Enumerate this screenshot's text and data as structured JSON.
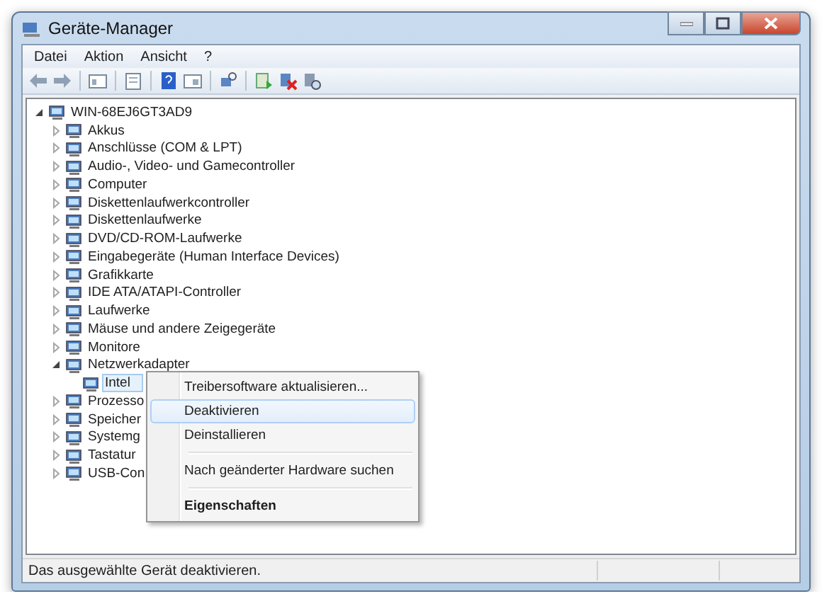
{
  "window": {
    "title": "Geräte-Manager"
  },
  "menu": [
    {
      "label": "Datei"
    },
    {
      "label": "Aktion"
    },
    {
      "label": "Ansicht"
    },
    {
      "label": "?"
    }
  ],
  "tree": {
    "label": "WIN-68EJ6GT3AD9",
    "expanded": true,
    "selected": false,
    "children": [
      {
        "label": "Akkus",
        "expanded": false,
        "selected": false
      },
      {
        "label": "Anschlüsse (COM & LPT)",
        "expanded": false,
        "selected": false
      },
      {
        "label": "Audio-, Video- und Gamecontroller",
        "expanded": false,
        "selected": false
      },
      {
        "label": "Computer",
        "expanded": false,
        "selected": false
      },
      {
        "label": "Diskettenlaufwerkcontroller",
        "expanded": false,
        "selected": false
      },
      {
        "label": "Diskettenlaufwerke",
        "expanded": false,
        "selected": false
      },
      {
        "label": "DVD/CD-ROM-Laufwerke",
        "expanded": false,
        "selected": false
      },
      {
        "label": "Eingabegeräte (Human Interface Devices)",
        "expanded": false,
        "selected": false
      },
      {
        "label": "Grafikkarte",
        "expanded": false,
        "selected": false
      },
      {
        "label": "IDE ATA/ATAPI-Controller",
        "expanded": false,
        "selected": false
      },
      {
        "label": "Laufwerke",
        "expanded": false,
        "selected": false
      },
      {
        "label": "Mäuse und andere Zeigegeräte",
        "expanded": false,
        "selected": false
      },
      {
        "label": "Monitore",
        "expanded": false,
        "selected": false
      },
      {
        "label": "Netzwerkadapter",
        "expanded": true,
        "selected": false,
        "children": [
          {
            "label": "Intel",
            "selected": true
          }
        ]
      },
      {
        "label": "Prozesso",
        "expanded": false,
        "selected": false
      },
      {
        "label": "Speicher",
        "expanded": false,
        "selected": false
      },
      {
        "label": "Systemg",
        "expanded": false,
        "selected": false
      },
      {
        "label": "Tastatur",
        "expanded": false,
        "selected": false
      },
      {
        "label": "USB-Con",
        "expanded": false,
        "selected": false
      }
    ]
  },
  "context_menu": {
    "items": [
      {
        "kind": "item",
        "label": "Treibersoftware aktualisieren...",
        "selected": false,
        "bold": false
      },
      {
        "kind": "item",
        "label": "Deaktivieren",
        "selected": true,
        "bold": false
      },
      {
        "kind": "item",
        "label": "Deinstallieren",
        "selected": false,
        "bold": false
      },
      {
        "kind": "separator"
      },
      {
        "kind": "item",
        "label": "Nach geänderter Hardware suchen",
        "selected": false,
        "bold": false
      },
      {
        "kind": "separator"
      },
      {
        "kind": "item",
        "label": "Eigenschaften",
        "selected": false,
        "bold": true
      }
    ]
  },
  "status_bar": {
    "text": "Das ausgewählte Gerät deaktivieren."
  }
}
